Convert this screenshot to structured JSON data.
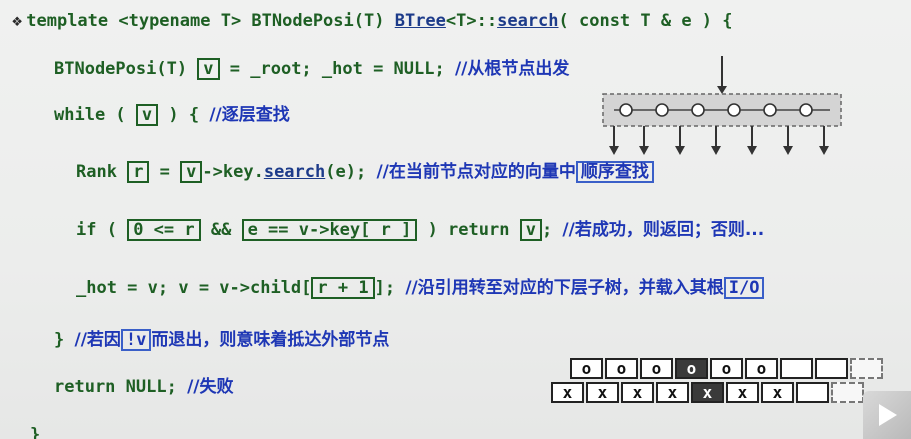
{
  "code": {
    "bullet": "❖",
    "l1": {
      "a": "template <typename T> BTNodePosi(T) ",
      "b": "BTree",
      "c": "<T>::",
      "d": "search",
      "e": "( const T & e ) {"
    },
    "l2": {
      "a": "BTNodePosi(T) ",
      "box": "v",
      "b": " = _root; _hot = NULL; ",
      "cmt": "//从根节点出发"
    },
    "l3": {
      "a": "while ( ",
      "box": "v",
      "b": " ) { ",
      "cmt": "//逐层查找"
    },
    "l4": {
      "a": "Rank ",
      "box1": "r",
      "b": " = ",
      "box2": "v",
      "c": "->key.",
      "d": "search",
      "e": "(e); ",
      "cmt": "//在当前节点对应的向量中",
      "cmtbox": "顺序查找"
    },
    "l5": {
      "a": "if ( ",
      "box1": "0 <= r ",
      "b": " && ",
      "box2": "e == v->key[ r ]",
      "c": " ) return ",
      "box3": "v",
      "d": "; ",
      "cmt": "//若成功，则返回；否则..."
    },
    "l6": {
      "a": "_hot = v; v = v->child[",
      "box": " r + 1 ",
      "b": "]; ",
      "cmt": "//沿引用转至对应的下层子树，并载入其根",
      "cmtbox": "I/O"
    },
    "l7": {
      "a": "} ",
      "cmt1": "//若因",
      "cmtbox": "!v",
      "cmt2": "而退出，则意味着抵达外部节点"
    },
    "l8": {
      "a": "return NULL; ",
      "cmt": "//失败"
    },
    "l9": {
      "a": "}"
    }
  },
  "memory": {
    "top_row": [
      "o",
      "o",
      "o",
      "o",
      "o",
      "o",
      "",
      "",
      ""
    ],
    "top_highlight_index": 3,
    "bottom_row": [
      "x",
      "x",
      "x",
      "x",
      "x",
      "x",
      "x",
      "",
      ""
    ],
    "bottom_highlight_index": 4
  },
  "colors": {
    "code": "#1e5f24",
    "comment": "#1e37b5",
    "background": "#eeefee"
  }
}
